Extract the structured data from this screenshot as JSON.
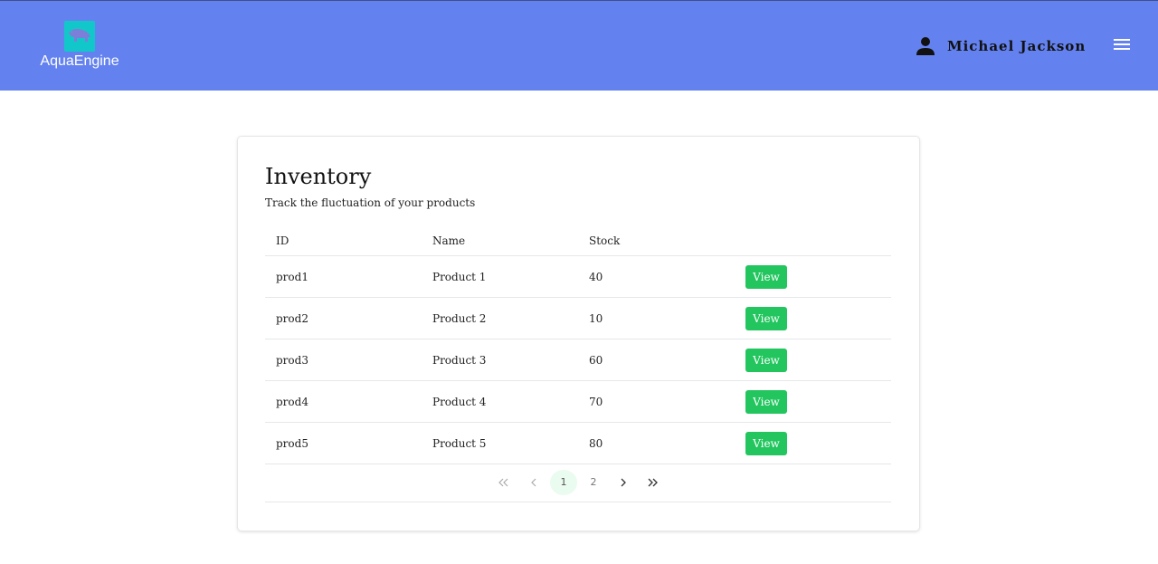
{
  "header": {
    "logo_text": "AquaEngine",
    "user_name": "Michael Jackson",
    "bg_color": "#6482ef"
  },
  "inventory": {
    "title": "Inventory",
    "subtitle": "Track the fluctuation of your products",
    "columns": [
      "ID",
      "Name",
      "Stock",
      ""
    ],
    "rows": [
      {
        "id": "prod1",
        "name": "Product 1",
        "stock": "40",
        "action": "View"
      },
      {
        "id": "prod2",
        "name": "Product 2",
        "stock": "10",
        "action": "View"
      },
      {
        "id": "prod3",
        "name": "Product 3",
        "stock": "60",
        "action": "View"
      },
      {
        "id": "prod4",
        "name": "Product 4",
        "stock": "70",
        "action": "View"
      },
      {
        "id": "prod5",
        "name": "Product 5",
        "stock": "80",
        "action": "View"
      }
    ],
    "action_color": "#22c55e"
  },
  "pagination": {
    "pages": [
      "1",
      "2"
    ],
    "current": "1"
  }
}
